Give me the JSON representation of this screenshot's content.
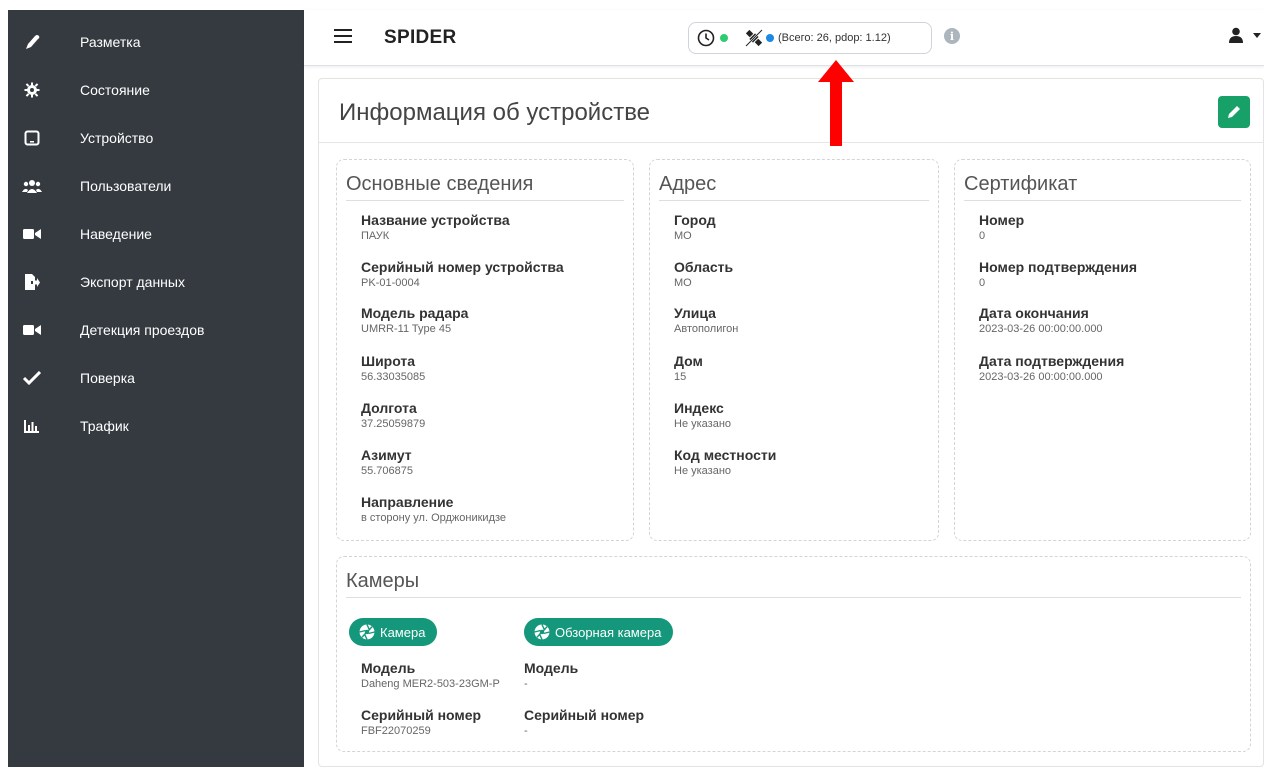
{
  "sidebar": {
    "items": [
      {
        "label": "Разметка",
        "icon": "marker-icon"
      },
      {
        "label": "Состояние",
        "icon": "gear-icon"
      },
      {
        "label": "Устройство",
        "icon": "tablet-icon"
      },
      {
        "label": "Пользователи",
        "icon": "users-icon"
      },
      {
        "label": "Наведение",
        "icon": "video-icon"
      },
      {
        "label": "Экспорт данных",
        "icon": "file-export-icon"
      },
      {
        "label": "Детекция проездов",
        "icon": "video-icon"
      },
      {
        "label": "Поверка",
        "icon": "check-icon"
      },
      {
        "label": "Трафик",
        "icon": "bar-chart-icon"
      }
    ]
  },
  "header": {
    "brand": "SPIDER",
    "status": {
      "clock_color": "#2ecc71",
      "satellite_color": "#1e88e5",
      "text": "(Всего: 26, pdop: 1.12)"
    }
  },
  "page": {
    "title": "Информация об устройстве"
  },
  "sections": {
    "main_info": {
      "title": "Основные сведения",
      "fields": [
        {
          "label": "Название устройства",
          "value": "ПАУК"
        },
        {
          "label": "Серийный номер устройства",
          "value": "PK-01-0004"
        },
        {
          "label": "Модель радара",
          "value": "UMRR-11 Type 45"
        },
        {
          "label": "Широта",
          "value": "56.33035085"
        },
        {
          "label": "Долгота",
          "value": "37.25059879"
        },
        {
          "label": "Азимут",
          "value": "55.706875"
        },
        {
          "label": "Направление",
          "value": "в сторону ул. Орджоникидзе"
        }
      ]
    },
    "address": {
      "title": "Адрес",
      "fields": [
        {
          "label": "Город",
          "value": "МО"
        },
        {
          "label": "Область",
          "value": "МО"
        },
        {
          "label": "Улица",
          "value": "Автополигон"
        },
        {
          "label": "Дом",
          "value": "15"
        },
        {
          "label": "Индекс",
          "value": "Не указано"
        },
        {
          "label": "Код местности",
          "value": "Не указано"
        }
      ]
    },
    "certificate": {
      "title": "Сертификат",
      "fields": [
        {
          "label": "Номер",
          "value": "0"
        },
        {
          "label": "Номер подтверждения",
          "value": "0"
        },
        {
          "label": "Дата окончания",
          "value": "2023-03-26 00:00:00.000"
        },
        {
          "label": "Дата подтверждения",
          "value": "2023-03-26 00:00:00.000"
        }
      ]
    },
    "cameras": {
      "title": "Камеры",
      "items": [
        {
          "button": "Камера",
          "model_label": "Модель",
          "model_value": "Daheng MER2-503-23GM-P",
          "serial_label": "Серийный номер",
          "serial_value": "FBF22070259"
        },
        {
          "button": "Обзорная камера",
          "model_label": "Модель",
          "model_value": "-",
          "serial_label": "Серийный номер",
          "serial_value": "-"
        }
      ]
    }
  },
  "colors": {
    "sidebar_bg": "#343a40",
    "accent_green": "#17a068",
    "camera_teal": "#14977a",
    "annotation_arrow": "#ff0000"
  }
}
